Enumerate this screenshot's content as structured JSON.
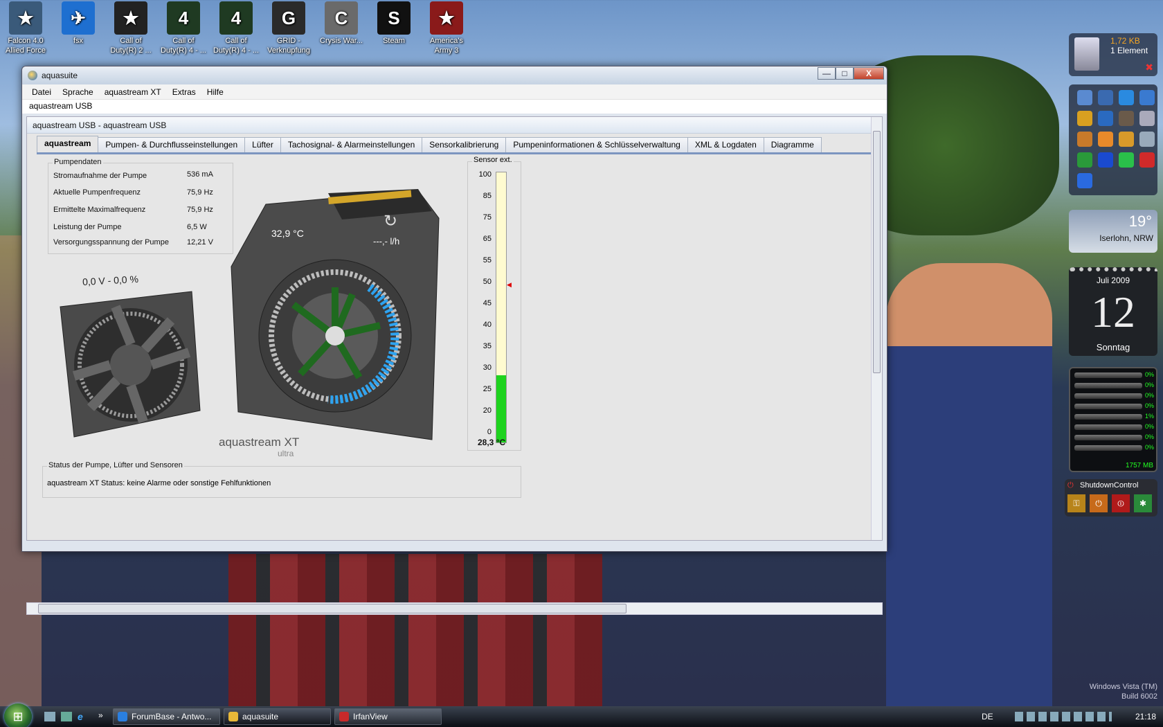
{
  "desktop": {
    "icons": [
      {
        "label": "Falcon 4.0 Allied Force",
        "color": "#3a5a7a",
        "glyph": "★"
      },
      {
        "label": "fsx",
        "color": "#1e6fd0",
        "glyph": "✈"
      },
      {
        "label": "Call of Duty(R) 2 ...",
        "color": "#222",
        "glyph": "★"
      },
      {
        "label": "Call of Duty(R) 4 - ...",
        "color": "#1f3a22",
        "glyph": "4"
      },
      {
        "label": "Call of Duty(R) 4 - ...",
        "color": "#1f3a22",
        "glyph": "4"
      },
      {
        "label": "GRID - Verknüpfung",
        "color": "#2a2a2a",
        "glyph": "G"
      },
      {
        "label": "Crysis War...",
        "color": "#6a6a6a",
        "glyph": "C"
      },
      {
        "label": "Steam",
        "color": "#111",
        "glyph": "S"
      },
      {
        "label": "America's Army 3",
        "color": "#8a1a1a",
        "glyph": "★"
      }
    ],
    "watermark_line1": "Windows Vista (TM)",
    "watermark_line2": "Build 6002"
  },
  "window": {
    "title": "aquasuite",
    "minimize": "—",
    "maximize": "□",
    "close": "X",
    "menu": [
      "Datei",
      "Sprache",
      "aquastream XT",
      "Extras",
      "Hilfe"
    ],
    "device_label": "aquastream USB",
    "inner_title": "aquastream USB - aquastream USB",
    "tabs": [
      "aquastream",
      "Pumpen- & Durchflusseinstellungen",
      "Lüfter",
      "Tachosignal- & Alarmeinstellungen",
      "Sensorkalibrierung",
      "Pumpeninformationen & Schlüsselverwaltung",
      "XML & Logdaten",
      "Diagramme"
    ],
    "active_tab": "aquastream"
  },
  "pump_data": {
    "title": "Pumpendaten",
    "rows": [
      {
        "label": "Stromaufnahme der Pumpe",
        "value": "536 mA"
      },
      {
        "label": "Aktuelle Pumpenfrequenz",
        "value": "75,9 Hz"
      },
      {
        "label": "Ermittelte Maximalfrequenz",
        "value": "75,9 Hz"
      },
      {
        "label": "Leistung der Pumpe",
        "value": "6,5 W"
      },
      {
        "label": "Versorgungsspannung der Pumpe",
        "value": "12,21 V"
      }
    ]
  },
  "fan": {
    "readout": "0,0 V - 0,0 %"
  },
  "pump_visual": {
    "temp": "32,9 °C",
    "flow": "---,- l/h",
    "brand": "aquastream XT",
    "sub": "ultra"
  },
  "sensor": {
    "title": "Sensor ext.",
    "scale": [
      "100",
      "85",
      "75",
      "65",
      "55",
      "50",
      "45",
      "40",
      "35",
      "30",
      "25",
      "20",
      "0"
    ],
    "reading": "28,3 °C",
    "fill_fraction": 0.25
  },
  "status": {
    "title": "Status der Pumpe, Lüfter und Sensoren",
    "text": "aquastream XT Status: keine Alarme oder sonstige Fehlfunktionen"
  },
  "gadgets": {
    "recycle_size": "1,72 KB",
    "recycle_items": "1 Element",
    "weather_temp": "19°",
    "weather_city": "Iserlohn, NRW",
    "calendar_month": "Juli 2009",
    "calendar_day": "12",
    "calendar_weekday": "Sonntag",
    "cpu_values": [
      "0%",
      "0%",
      "0%",
      "0%",
      "1%",
      "0%",
      "0%",
      "0%"
    ],
    "mem": "1757 MB",
    "shutdown_title": "ShutdownControl"
  },
  "taskbar": {
    "items": [
      {
        "label": "ForumBase - Antwo...",
        "color": "#2a7fe0"
      },
      {
        "label": "aquasuite",
        "color": "#e8b838"
      },
      {
        "label": "IrfanView",
        "color": "#c92a2a"
      }
    ],
    "lang": "DE",
    "clock": "21:18"
  }
}
